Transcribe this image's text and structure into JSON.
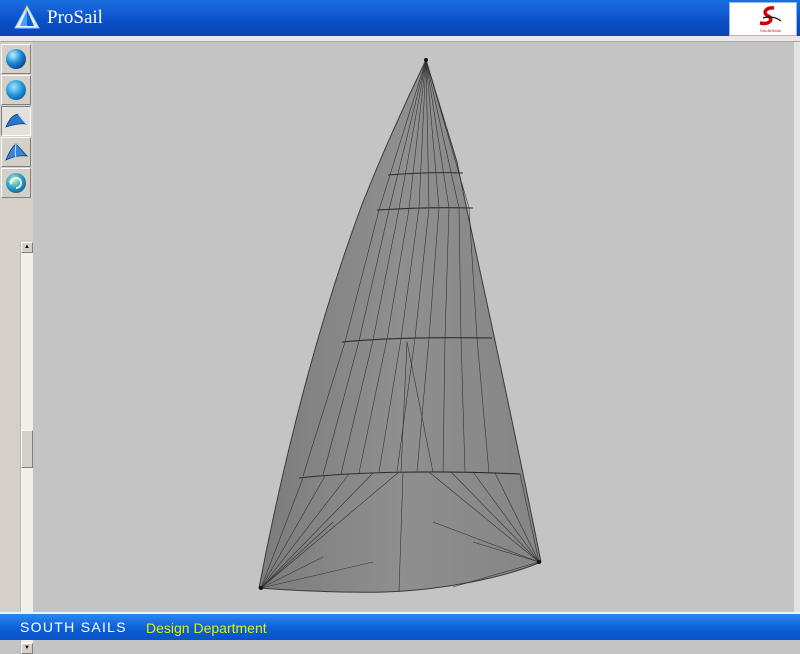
{
  "window": {
    "title": "ProSail"
  },
  "brand": {
    "logo_text": "SouthSails"
  },
  "toolbar": {
    "buttons": [
      {
        "name": "view-globe-button",
        "icon": "globe-icon"
      },
      {
        "name": "view-globe-alt-button",
        "icon": "globe-icon"
      },
      {
        "name": "sail-view-front-button",
        "icon": "sail-shape-icon",
        "pressed": true
      },
      {
        "name": "sail-view-side-button",
        "icon": "sail-shape-icon"
      },
      {
        "name": "refresh-view-button",
        "icon": "rotate-globe-icon"
      }
    ]
  },
  "status": {
    "company": "SOUTH SAILS",
    "department": "Design Department"
  },
  "colors": {
    "titlebar": "#0a4fc8",
    "statusbar": "#0c5fd8",
    "department_text": "#e4f000",
    "sail_fill": "#8a8a8a",
    "background": "#c4c4c4"
  }
}
